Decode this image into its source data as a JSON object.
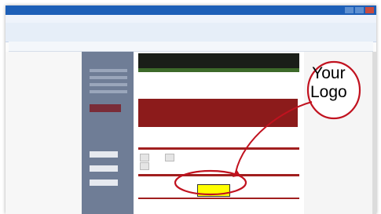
{
  "callout": {
    "line1": "Your",
    "line2": "Logo"
  },
  "placeholder_color": "#ffff00",
  "annotation_color": "#c1121f",
  "icons": [
    "close-icon"
  ]
}
